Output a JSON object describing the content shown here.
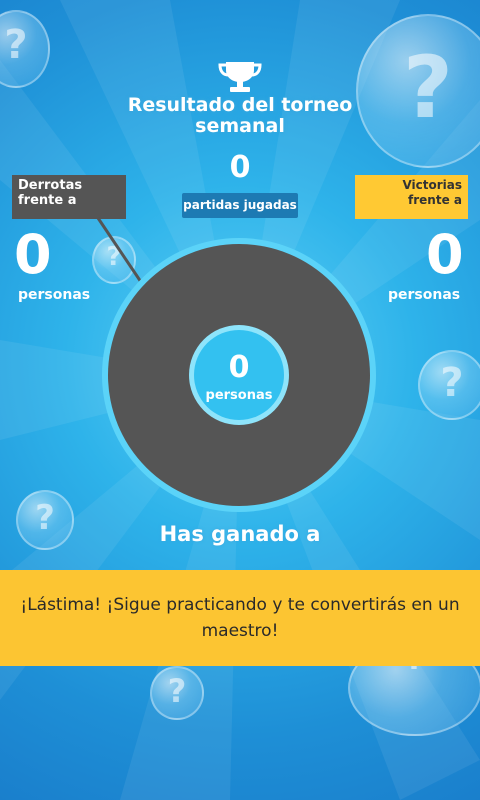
{
  "header": {
    "title": "Resultado del torneo semanal",
    "games_count": "0",
    "games_label": "partidas jugadas"
  },
  "losses": {
    "tag": "Derrotas frente a",
    "count": "0",
    "unit": "personas",
    "color": "#555555"
  },
  "wins": {
    "tag": "Victorias frente a",
    "count": "0",
    "unit": "personas",
    "color": "#FFC933"
  },
  "donut": {
    "center_count": "0",
    "center_unit": "personas"
  },
  "won_label": "Has ganado a",
  "banner": {
    "message": "¡Lástima! ¡Sigue practicando y te convertirás en un maestro!",
    "color": "#FCC532"
  },
  "icons": [
    "trophy-icon",
    "question-bubble-icon"
  ]
}
